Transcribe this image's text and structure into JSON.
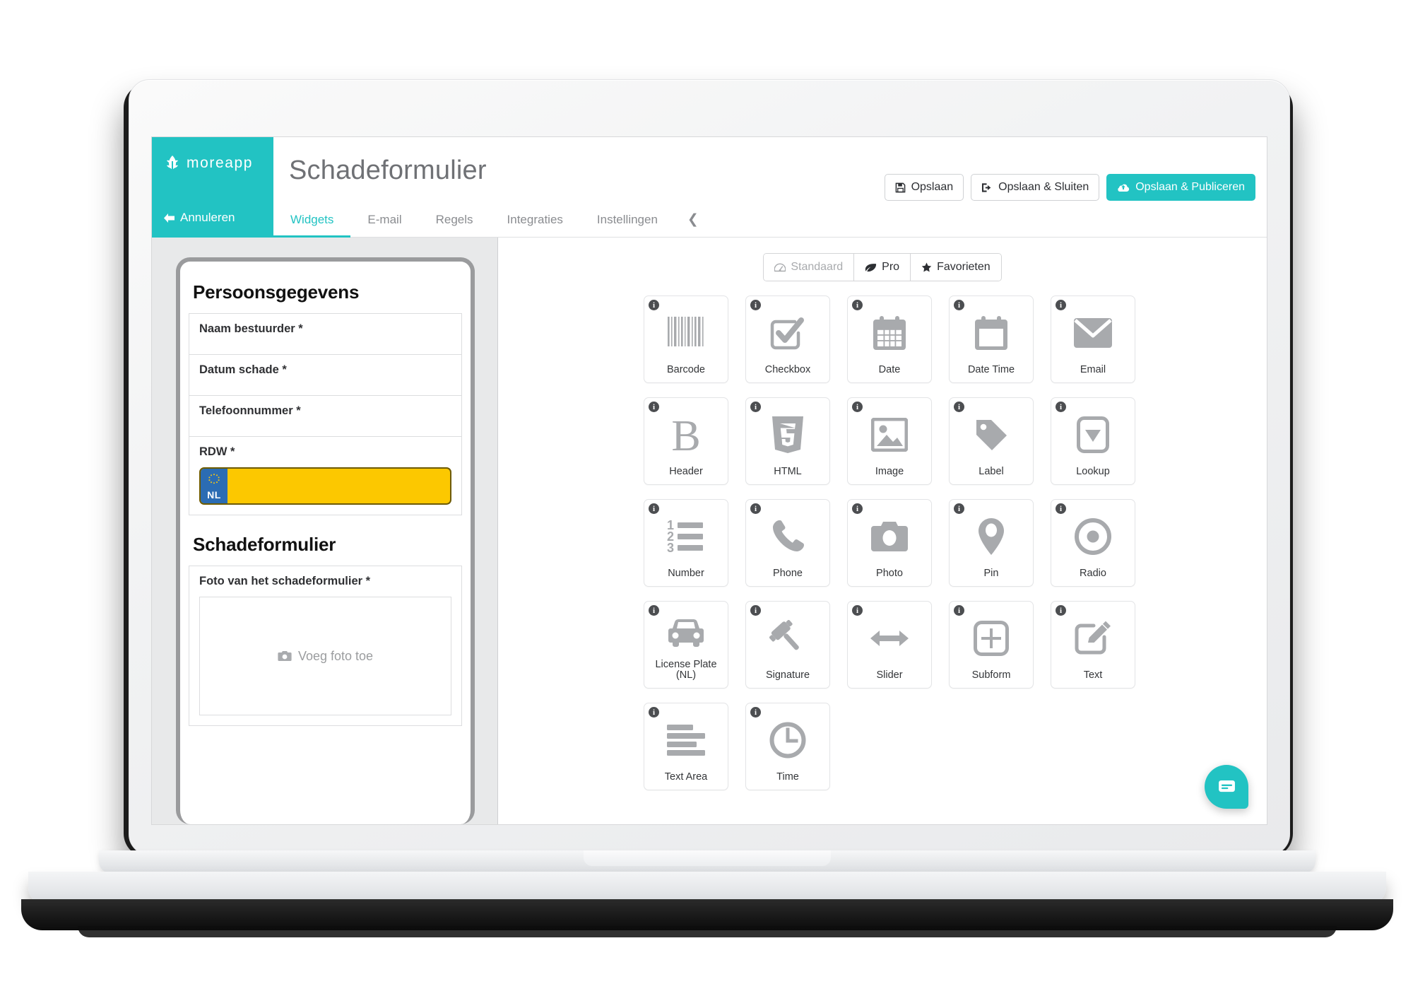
{
  "brand": {
    "name": "moreapp",
    "logo_icon": "wheat-sprout-icon",
    "color": "#22c3c3"
  },
  "topbar": {
    "cancel_label": "Annuleren",
    "cancel_icon": "arrow-left-icon",
    "form_title": "Schadeformulier"
  },
  "tabs": [
    {
      "label": "Widgets",
      "active": true
    },
    {
      "label": "E-mail",
      "active": false
    },
    {
      "label": "Regels",
      "active": false
    },
    {
      "label": "Integraties",
      "active": false
    },
    {
      "label": "Instellingen",
      "active": false
    }
  ],
  "collapse_icon": "chevron-left-icon",
  "actions": [
    {
      "label": "Opslaan",
      "icon": "floppy-disk-icon",
      "primary": false
    },
    {
      "label": "Opslaan & Sluiten",
      "icon": "sign-out-icon",
      "primary": false
    },
    {
      "label": "Opslaan & Publiceren",
      "icon": "cloud-upload-icon",
      "primary": true
    }
  ],
  "filters": [
    {
      "label": "Standaard",
      "icon": "dashboard-icon",
      "muted": true
    },
    {
      "label": "Pro",
      "icon": "leaf-icon",
      "muted": false
    },
    {
      "label": "Favorieten",
      "icon": "star-icon",
      "muted": false
    }
  ],
  "preview": {
    "sections": [
      {
        "title": "Persoonsgegevens"
      },
      {
        "title": "Schadeformulier"
      }
    ],
    "fields": [
      {
        "label": "Naam bestuurder *"
      },
      {
        "label": "Datum schade *"
      },
      {
        "label": "Telefoonnummer *"
      },
      {
        "label": "RDW *"
      }
    ],
    "license_plate": {
      "country_code": "NL",
      "value": "",
      "plate_color": "#fcc800",
      "eu_band_color": "#2b6cb3"
    },
    "photo_field": {
      "label": "Foto van het schadeformulier *",
      "placeholder": "Voeg foto toe",
      "icon": "camera-icon"
    }
  },
  "widgets": [
    {
      "label": "Barcode",
      "icon": "barcode-icon",
      "info_icon": "info-icon"
    },
    {
      "label": "Checkbox",
      "icon": "checkbox-icon",
      "info_icon": "info-icon"
    },
    {
      "label": "Date",
      "icon": "calendar-icon",
      "info_icon": "info-icon"
    },
    {
      "label": "Date Time",
      "icon": "calendar-blank-icon",
      "info_icon": "info-icon"
    },
    {
      "label": "Email",
      "icon": "envelope-icon",
      "info_icon": "info-icon"
    },
    {
      "label": "Header",
      "icon": "letter-b-icon",
      "info_icon": "info-icon"
    },
    {
      "label": "HTML",
      "icon": "html5-icon",
      "info_icon": "info-icon"
    },
    {
      "label": "Image",
      "icon": "image-icon",
      "info_icon": "info-icon"
    },
    {
      "label": "Label",
      "icon": "tag-icon",
      "info_icon": "info-icon"
    },
    {
      "label": "Lookup",
      "icon": "dropdown-icon",
      "info_icon": "info-icon"
    },
    {
      "label": "Number",
      "icon": "numbered-list-icon",
      "info_icon": "info-icon"
    },
    {
      "label": "Phone",
      "icon": "phone-icon",
      "info_icon": "info-icon"
    },
    {
      "label": "Photo",
      "icon": "camera-icon",
      "info_icon": "info-icon"
    },
    {
      "label": "Pin",
      "icon": "map-pin-icon",
      "info_icon": "info-icon"
    },
    {
      "label": "Radio",
      "icon": "radio-button-icon",
      "info_icon": "info-icon"
    },
    {
      "label": "License Plate (NL)",
      "icon": "car-icon",
      "info_icon": "info-icon"
    },
    {
      "label": "Signature",
      "icon": "gavel-icon",
      "info_icon": "info-icon"
    },
    {
      "label": "Slider",
      "icon": "arrows-horizontal-icon",
      "info_icon": "info-icon"
    },
    {
      "label": "Subform",
      "icon": "plus-square-icon",
      "info_icon": "info-icon"
    },
    {
      "label": "Text",
      "icon": "pencil-square-icon",
      "info_icon": "info-icon"
    },
    {
      "label": "Text Area",
      "icon": "text-lines-icon",
      "info_icon": "info-icon"
    },
    {
      "label": "Time",
      "icon": "clock-icon",
      "info_icon": "info-icon"
    }
  ],
  "chat": {
    "icon": "chat-bubble-icon"
  }
}
